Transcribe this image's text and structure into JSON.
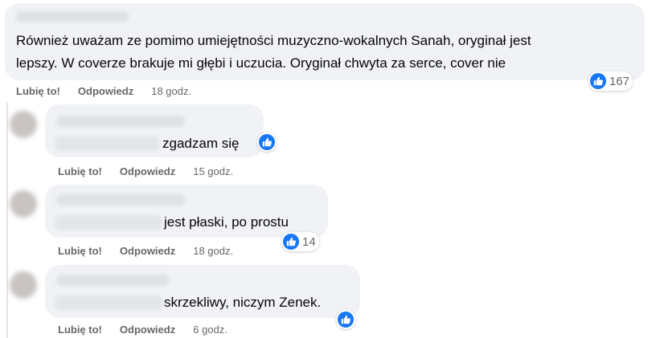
{
  "colors": {
    "like_blue": "#1877f2",
    "bubble_bg": "#f0f2f5",
    "meta_gray": "#65676b"
  },
  "icons": {
    "reaction": "thumbs-up-icon"
  },
  "comments": [
    {
      "text_lines": [
        "Również uważam ze pomimo umiejętności muzyczno-wokalnych Sanah, oryginał jest",
        "lepszy. W coverze brakuje mi głębi i uczucia. Oryginał chwyta za serce, cover nie"
      ],
      "like_label": "Lubię to!",
      "reply_label": "Odpowiedz",
      "time": "18 godz.",
      "reactions": "167"
    },
    {
      "text": "zgadzam się",
      "like_label": "Lubię to!",
      "reply_label": "Odpowiedz",
      "time": "15 godz."
    },
    {
      "text": "jest płaski, po prostu",
      "like_label": "Lubię to!",
      "reply_label": "Odpowiedz",
      "time": "18 godz.",
      "reactions": "14"
    },
    {
      "text": "skrzekliwy, niczym Zenek.",
      "like_label": "Lubię to!",
      "reply_label": "Odpowiedz",
      "time": "6 godz."
    }
  ]
}
